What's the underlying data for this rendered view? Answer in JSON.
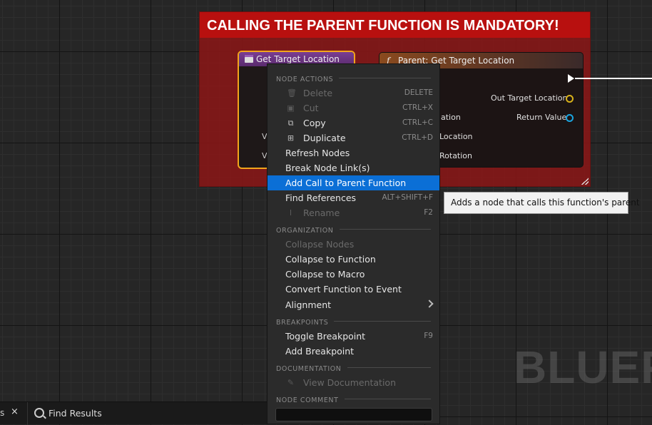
{
  "watermark": "BLUEPR",
  "comment": {
    "title": "CALLING THE PARENT FUNCTION IS MANDATORY!"
  },
  "node_a": {
    "title": "Get Target Location",
    "partial_labels": [
      "V",
      "V"
    ]
  },
  "node_b": {
    "title": "Parent: Get Target Location",
    "function_symbol": "f",
    "outputs": [
      "Out Target Location",
      "Return Value"
    ],
    "inputs_partial": [
      "ation",
      "Location",
      "Rotation"
    ],
    "colors": {
      "out_target_location": "#d8b21a",
      "return_value": "#1aa5e0"
    }
  },
  "context_menu": {
    "sections": {
      "node_actions": "NODE ACTIONS",
      "organization": "ORGANIZATION",
      "breakpoints": "BREAKPOINTS",
      "documentation": "DOCUMENTATION",
      "node_comment": "NODE COMMENT"
    },
    "items": {
      "delete": {
        "label": "Delete",
        "shortcut": "DELETE",
        "icon": "trash-icon"
      },
      "cut": {
        "label": "Cut",
        "shortcut": "CTRL+X",
        "icon": "cut-icon"
      },
      "copy": {
        "label": "Copy",
        "shortcut": "CTRL+C",
        "icon": "copy-icon"
      },
      "duplicate": {
        "label": "Duplicate",
        "shortcut": "CTRL+D",
        "icon": "duplicate-icon"
      },
      "refresh_nodes": {
        "label": "Refresh Nodes"
      },
      "break_links": {
        "label": "Break Node Link(s)"
      },
      "add_call_parent": {
        "label": "Add Call to Parent Function"
      },
      "find_references": {
        "label": "Find References",
        "shortcut": "ALT+SHIFT+F"
      },
      "rename": {
        "label": "Rename",
        "shortcut": "F2",
        "icon": "rename-icon"
      },
      "collapse_nodes": {
        "label": "Collapse Nodes"
      },
      "collapse_function": {
        "label": "Collapse to Function"
      },
      "collapse_macro": {
        "label": "Collapse to Macro"
      },
      "convert_event": {
        "label": "Convert Function to Event"
      },
      "alignment": {
        "label": "Alignment"
      },
      "toggle_breakpoint": {
        "label": "Toggle Breakpoint",
        "shortcut": "F9"
      },
      "add_breakpoint": {
        "label": "Add Breakpoint"
      },
      "view_docs": {
        "label": "View Documentation",
        "icon": "docs-icon"
      }
    },
    "highlight_color": "#0b6fd6"
  },
  "tooltip": {
    "text": "Adds a node that calls this function's parent"
  },
  "bottom_bar": {
    "prev_tab_fragment": "s",
    "close_symbol": "×",
    "find_results_label": "Find Results"
  }
}
